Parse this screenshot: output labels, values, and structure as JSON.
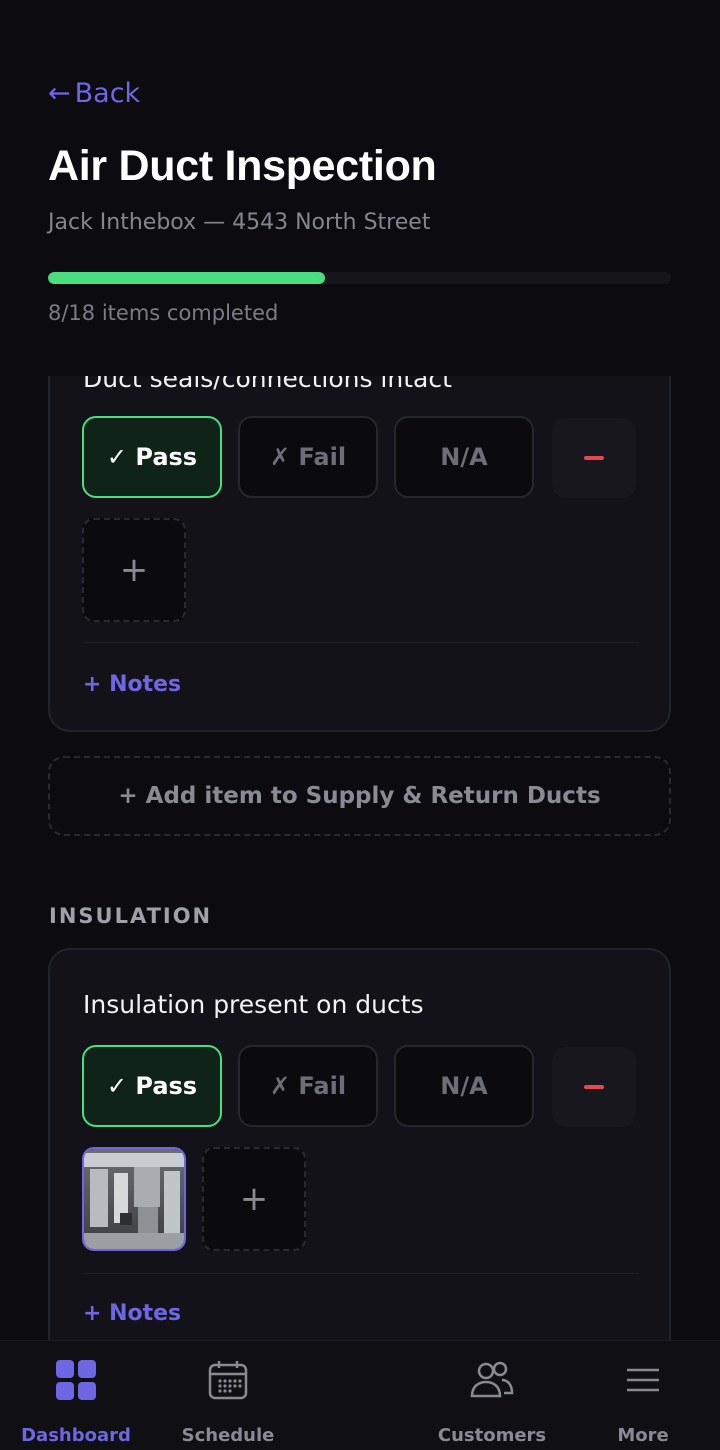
{
  "header": {
    "back_label": "Back",
    "title": "Air Duct Inspection",
    "subtitle": "Jack Inthebox — 4543 North Street",
    "progress_fraction": 0.444,
    "progress_text": "8/18 items completed"
  },
  "cards": [
    {
      "title": "Duct seals/connections intact",
      "pass_label": "✓ Pass",
      "fail_label": "✗ Fail",
      "na_label": "N/A",
      "selected": "pass",
      "add_photo_label": "+",
      "notes_label": "+ Notes"
    },
    {
      "title": "Insulation present on ducts",
      "pass_label": "✓ Pass",
      "fail_label": "✗ Fail",
      "na_label": "N/A",
      "selected": "pass",
      "add_photo_label": "+",
      "notes_label": "+ Notes"
    }
  ],
  "add_item_label": "+ Add item to Supply & Return Ducts",
  "section_label": "INSULATION",
  "nav": {
    "items": [
      {
        "label": "Dashboard",
        "icon": "grid-icon",
        "active": true
      },
      {
        "label": "Schedule",
        "icon": "calendar-icon",
        "active": false
      },
      {
        "label": "Customers",
        "icon": "users-icon",
        "active": false
      },
      {
        "label": "More",
        "icon": "menu-icon",
        "active": false
      }
    ]
  },
  "colors": {
    "accent": "#6d67e4",
    "pass": "#4ade80",
    "remove": "#e5484d",
    "background": "#0b0b10"
  }
}
